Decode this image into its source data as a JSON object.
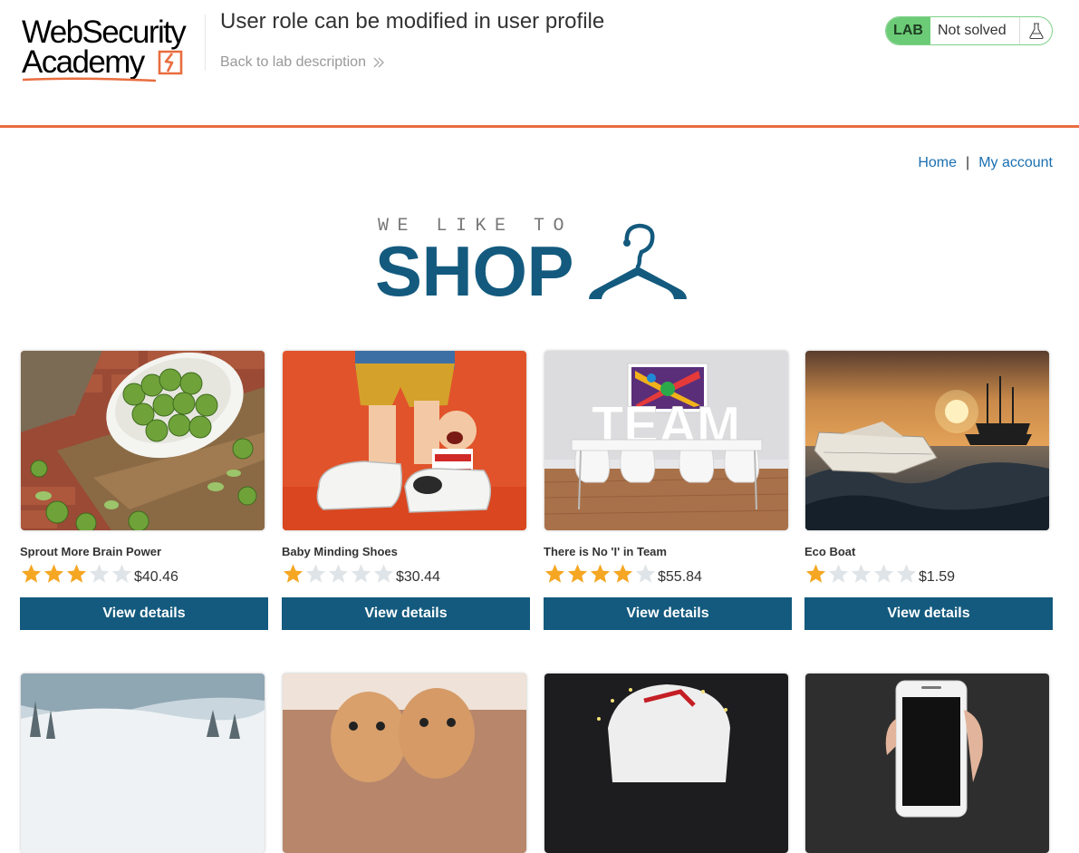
{
  "header": {
    "logo_line1": "WebSecurity",
    "logo_line2": "Academy",
    "lab_title": "User role can be modified in user profile",
    "back_link": "Back to lab description",
    "lab_badge": "LAB",
    "lab_status": "Not solved",
    "colors": {
      "accent": "#e96d3f",
      "badge": "#6ccb76"
    }
  },
  "nav": {
    "home": "Home",
    "separator": "|",
    "my_account": "My account"
  },
  "banner": {
    "small": "WE LIKE TO",
    "big": "SHOP",
    "color": "#135a7e"
  },
  "products": [
    {
      "name": "Sprout More Brain Power",
      "rating": 3,
      "price": "$40.46",
      "button": "View details",
      "image": "brussels-sprouts"
    },
    {
      "name": "Baby Minding Shoes",
      "rating": 1,
      "price": "$30.44",
      "button": "View details",
      "image": "figurine-shoes"
    },
    {
      "name": "There is No 'I' in Team",
      "rating": 4,
      "price": "$55.84",
      "button": "View details",
      "image": "team-letters"
    },
    {
      "name": "Eco Boat",
      "rating": 1,
      "price": "$1.59",
      "button": "View details",
      "image": "paper-boat"
    }
  ],
  "products_row2": [
    {
      "image": "snowy-landscape"
    },
    {
      "image": "eggs"
    },
    {
      "image": "cartoon-face"
    },
    {
      "image": "phone-in-hand"
    }
  ]
}
